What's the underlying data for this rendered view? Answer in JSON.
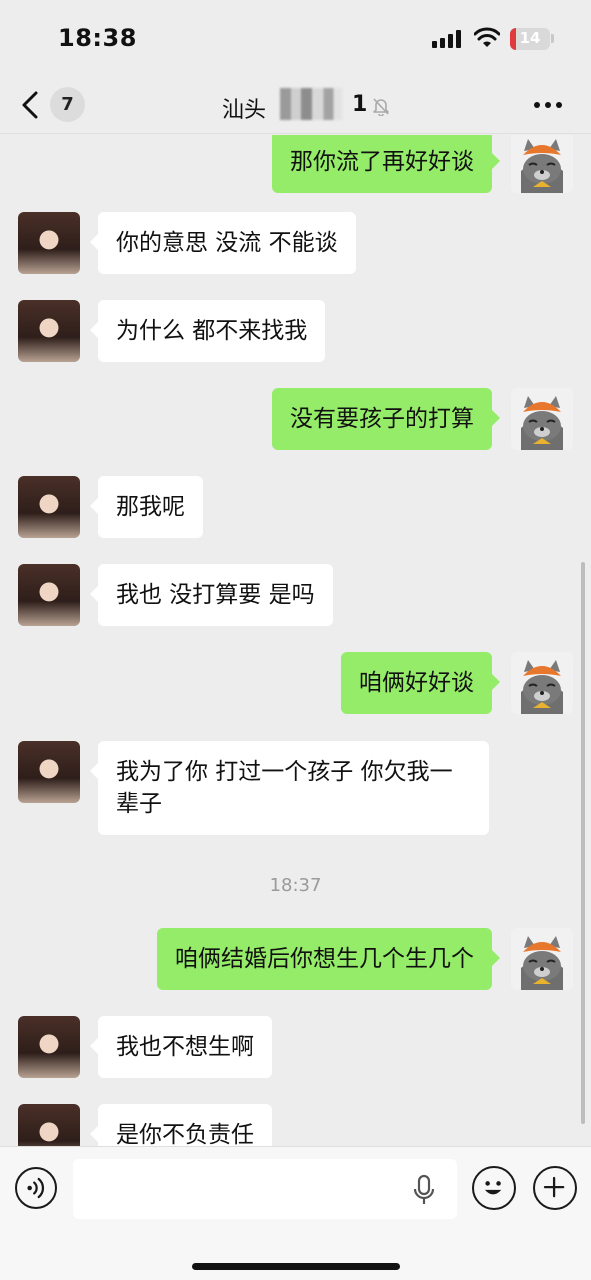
{
  "status_bar": {
    "time": "18:38",
    "battery": "14",
    "battery_level": 0.14
  },
  "nav": {
    "unread_count": "7",
    "title_prefix": "汕头",
    "title_suffix": "1"
  },
  "messages": [
    {
      "side": "right",
      "text": "那你流了再好好谈"
    },
    {
      "side": "left",
      "text": "你的意思 没流 不能谈"
    },
    {
      "side": "left",
      "text": "为什么 都不来找我"
    },
    {
      "side": "right",
      "text": "没有要孩子的打算"
    },
    {
      "side": "left",
      "text": "那我呢"
    },
    {
      "side": "left",
      "text": "我也 没打算要 是吗"
    },
    {
      "side": "right",
      "text": "咱俩好好谈"
    },
    {
      "side": "left",
      "text": "我为了你 打过一个孩子 你欠我一辈子"
    },
    {
      "side": "time",
      "text": "18:37"
    },
    {
      "side": "right",
      "text": "咱俩结婚后你想生几个生几个"
    },
    {
      "side": "left",
      "text": "我也不想生啊"
    },
    {
      "side": "left",
      "text": "是你不负责任"
    }
  ],
  "input": {
    "value": "",
    "placeholder": ""
  },
  "colors": {
    "sent_bubble": "#95ec69",
    "received_bubble": "#ffffff",
    "background": "#ededed"
  },
  "icons": [
    "back-chevron-icon",
    "mute-bell-icon",
    "more-icon",
    "voice-icon",
    "mic-icon",
    "emoji-icon",
    "plus-icon"
  ]
}
